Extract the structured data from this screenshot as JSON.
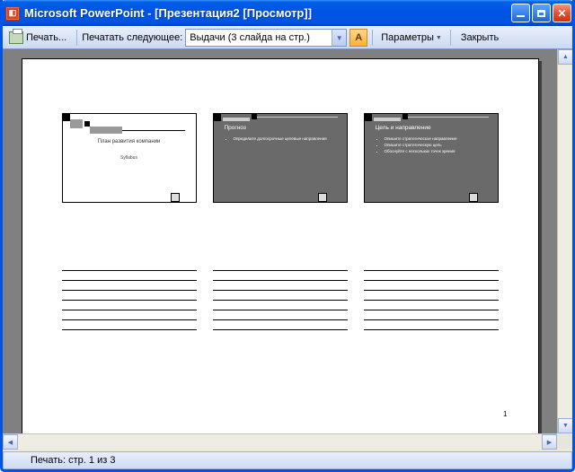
{
  "titlebar": {
    "title": "Microsoft PowerPoint - [Презентация2 [Просмотр]]"
  },
  "toolbar": {
    "print_label": "Печать...",
    "print_what_label": "Печатать следующее:",
    "combo_value": "Выдачи (3 слайда на стр.)",
    "orient_letter": "A",
    "options_label": "Параметры",
    "close_label": "Закрыть"
  },
  "handout": {
    "page_number": "1",
    "slides": [
      {
        "title": "План развития компании",
        "subtitle": "Syllabus",
        "theme": "light"
      },
      {
        "title": "Прогноз",
        "bullets": [
          "Определите долгосрочные целевые направления"
        ],
        "theme": "dark"
      },
      {
        "title": "Цель и направление",
        "bullets": [
          "Опишите стратегическое направление",
          "Опишите стратегическую цель",
          "Обоснуйте с нескольких точек зрения"
        ],
        "theme": "dark"
      }
    ]
  },
  "statusbar": {
    "text": "Печать: стр. 1 из 3"
  }
}
